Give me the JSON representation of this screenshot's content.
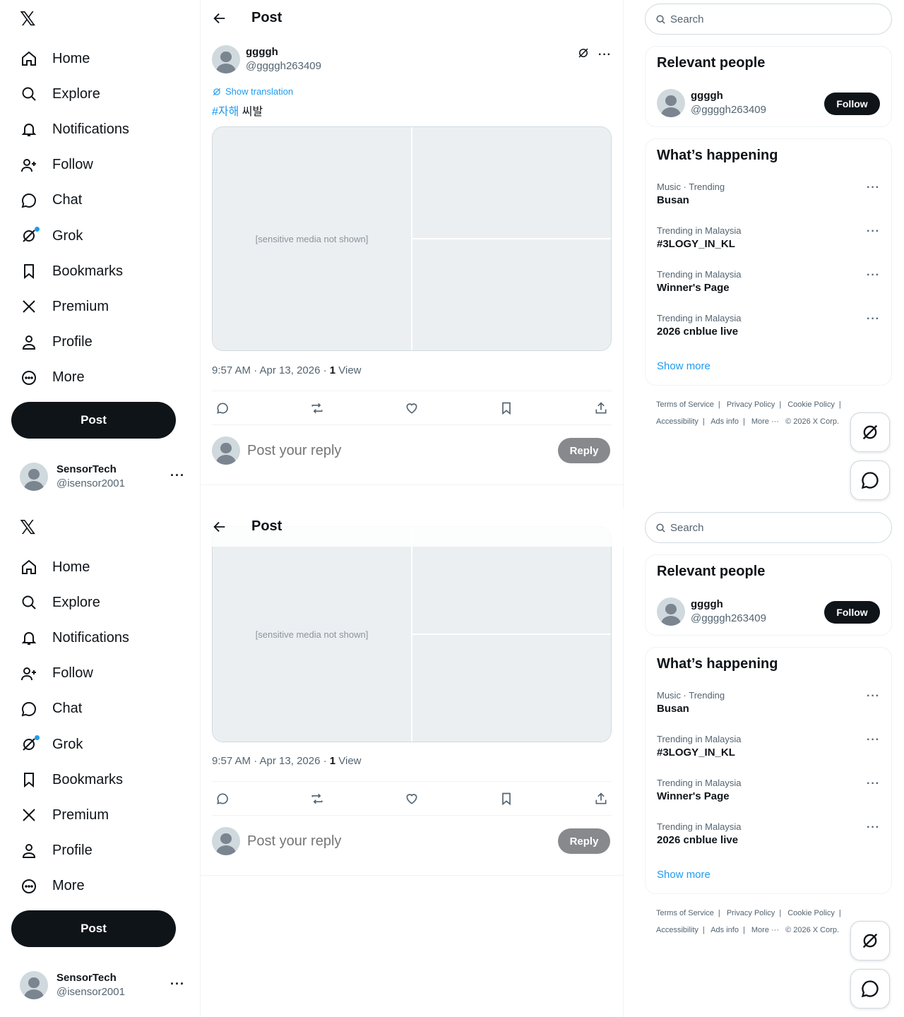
{
  "nav": {
    "logo": "𝕏",
    "items": [
      {
        "label": "Home",
        "icon": "home-icon"
      },
      {
        "label": "Explore",
        "icon": "search-icon"
      },
      {
        "label": "Notifications",
        "icon": "bell-icon"
      },
      {
        "label": "Follow",
        "icon": "follow-icon"
      },
      {
        "label": "Chat",
        "icon": "chat-icon"
      },
      {
        "label": "Grok",
        "icon": "grok-icon"
      },
      {
        "label": "Bookmarks",
        "icon": "bookmark-icon"
      },
      {
        "label": "Premium",
        "icon": "x-icon"
      },
      {
        "label": "Profile",
        "icon": "person-icon"
      },
      {
        "label": "More",
        "icon": "more-circle-icon"
      }
    ],
    "post_label": "Post"
  },
  "account": {
    "name": "SensorTech",
    "handle": "@isensor2001",
    "more": "···"
  },
  "header": {
    "title": "Post"
  },
  "post": {
    "author_name": "ggggh",
    "author_handle": "@ggggh263409",
    "show_translation": "Show translation",
    "hashtag": "#자해",
    "text": "씨발",
    "media_note": "[sensitive media not shown]",
    "timestamp": "9:57 AM · Apr 13, 2026 · ",
    "views_count": "1",
    "views_label": " View"
  },
  "reply": {
    "placeholder": "Post your reply",
    "button": "Reply"
  },
  "search": {
    "placeholder": "Search"
  },
  "relevant": {
    "title": "Relevant people",
    "name": "ggggh",
    "handle": "@ggggh263409",
    "follow": "Follow"
  },
  "happening": {
    "title": "What’s happening",
    "trends": [
      {
        "context": "Music · Trending",
        "name": "Busan"
      },
      {
        "context": "Trending in Malaysia",
        "name": "#3LOGY_IN_KL"
      },
      {
        "context": "Trending in Malaysia",
        "name": "Winner's Page"
      },
      {
        "context": "Trending in Malaysia",
        "name": "2026 cnblue live"
      }
    ],
    "show_more": "Show more",
    "more": "···"
  },
  "footer": {
    "links": [
      "Terms of Service",
      "|",
      "Privacy Policy",
      "|",
      "Cookie Policy",
      "|",
      "Accessibility",
      "|",
      "Ads info",
      "|",
      "More ···",
      "© 2026 X Corp."
    ]
  }
}
